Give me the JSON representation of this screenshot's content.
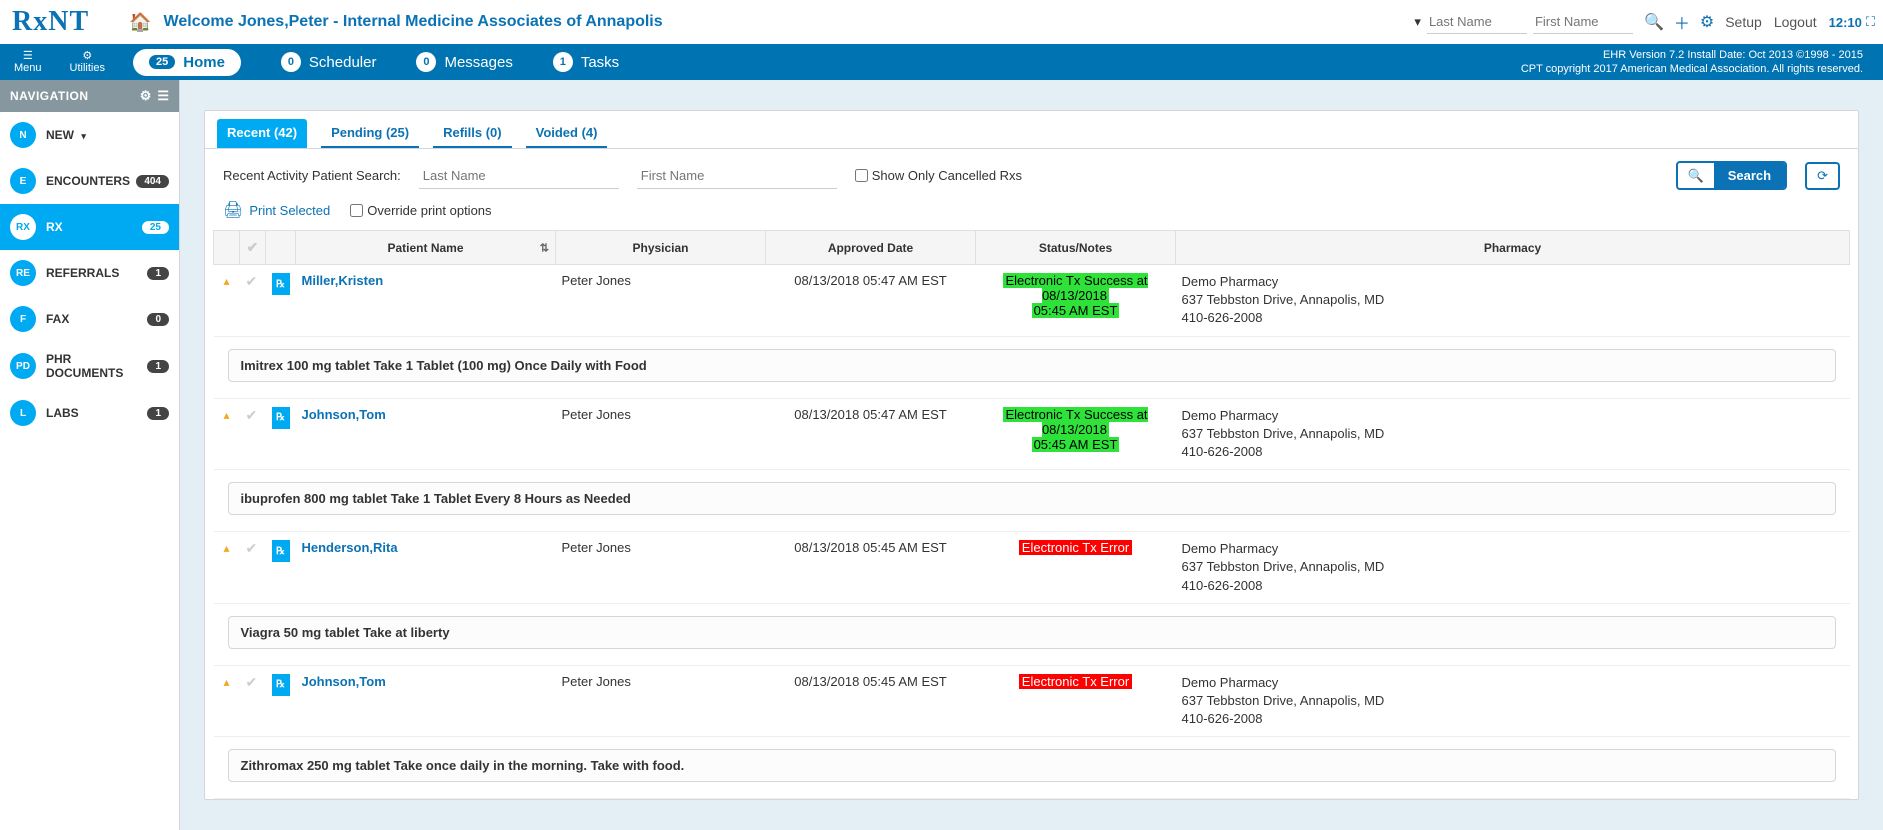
{
  "header": {
    "logo": "RxNT",
    "welcome": "Welcome Jones,Peter - Internal Medicine Associates of Annapolis",
    "last_name_ph": "Last Name",
    "first_name_ph": "First Name",
    "setup": "Setup",
    "logout": "Logout",
    "time": "12:10"
  },
  "navbar": {
    "menu": "Menu",
    "utilities": "Utilities",
    "home_badge": "25",
    "home": "Home",
    "scheduler_badge": "0",
    "scheduler": "Scheduler",
    "messages_badge": "0",
    "messages": "Messages",
    "tasks_badge": "1",
    "tasks": "Tasks",
    "info1": "EHR Version 7.2 Install Date: Oct 2013 ©1998 - 2015",
    "info2": "CPT copyright 2017 American Medical Association. All rights reserved."
  },
  "sidebar": {
    "title": "NAVIGATION",
    "items": [
      {
        "abbr": "N",
        "label": "NEW",
        "count": "",
        "dropdown": true
      },
      {
        "abbr": "E",
        "label": "ENCOUNTERS",
        "count": "404"
      },
      {
        "abbr": "RX",
        "label": "RX",
        "count": "25",
        "active": true
      },
      {
        "abbr": "RE",
        "label": "REFERRALS",
        "count": "1"
      },
      {
        "abbr": "F",
        "label": "FAX",
        "count": "0"
      },
      {
        "abbr": "PD",
        "label": "PHR DOCUMENTS",
        "count": "1"
      },
      {
        "abbr": "L",
        "label": "LABS",
        "count": "1"
      }
    ]
  },
  "tabs": [
    {
      "label": "Recent (42)",
      "active": true
    },
    {
      "label": "Pending (25)"
    },
    {
      "label": "Refills (0)"
    },
    {
      "label": "Voided (4)"
    }
  ],
  "search": {
    "label": "Recent Activity Patient Search:",
    "last_ph": "Last Name",
    "first_ph": "First Name",
    "cancelled": "Show Only Cancelled Rxs",
    "search_btn": "Search"
  },
  "print": {
    "btn": "Print Selected",
    "override": "Override print options"
  },
  "thead": {
    "patient": "Patient Name",
    "physician": "Physician",
    "approved": "Approved Date",
    "status": "Status/Notes",
    "pharmacy": "Pharmacy"
  },
  "rows": [
    {
      "patient": "Miller,Kristen",
      "physician": "Peter Jones",
      "date": "08/13/2018 05:47 AM EST",
      "status_type": "ok",
      "status1": "Electronic Tx Success at 08/13/2018",
      "status2": "05:45 AM EST",
      "pharm1": "Demo Pharmacy",
      "pharm2": "637 Tebbston Drive, Annapolis, MD",
      "pharm3": "410-626-2008",
      "med": "Imitrex 100 mg tablet Take 1 Tablet (100 mg) Once Daily with Food"
    },
    {
      "patient": "Johnson,Tom",
      "physician": "Peter Jones",
      "date": "08/13/2018 05:47 AM EST",
      "status_type": "ok",
      "status1": "Electronic Tx Success at 08/13/2018",
      "status2": "05:45 AM EST",
      "pharm1": "Demo Pharmacy",
      "pharm2": "637 Tebbston Drive, Annapolis, MD",
      "pharm3": "410-626-2008",
      "med": "ibuprofen 800 mg tablet Take 1 Tablet Every 8 Hours as Needed"
    },
    {
      "patient": "Henderson,Rita",
      "physician": "Peter Jones",
      "date": "08/13/2018 05:45 AM EST",
      "status_type": "err",
      "status1": "Electronic Tx Error",
      "pharm1": "Demo Pharmacy",
      "pharm2": "637 Tebbston Drive, Annapolis, MD",
      "pharm3": "410-626-2008",
      "med": "Viagra 50 mg tablet Take at liberty"
    },
    {
      "patient": "Johnson,Tom",
      "physician": "Peter Jones",
      "date": "08/13/2018 05:45 AM EST",
      "status_type": "err",
      "status1": "Electronic Tx Error",
      "pharm1": "Demo Pharmacy",
      "pharm2": "637 Tebbston Drive, Annapolis, MD",
      "pharm3": "410-626-2008",
      "med": "Zithromax 250 mg tablet Take once daily in the morning. Take with food."
    }
  ]
}
